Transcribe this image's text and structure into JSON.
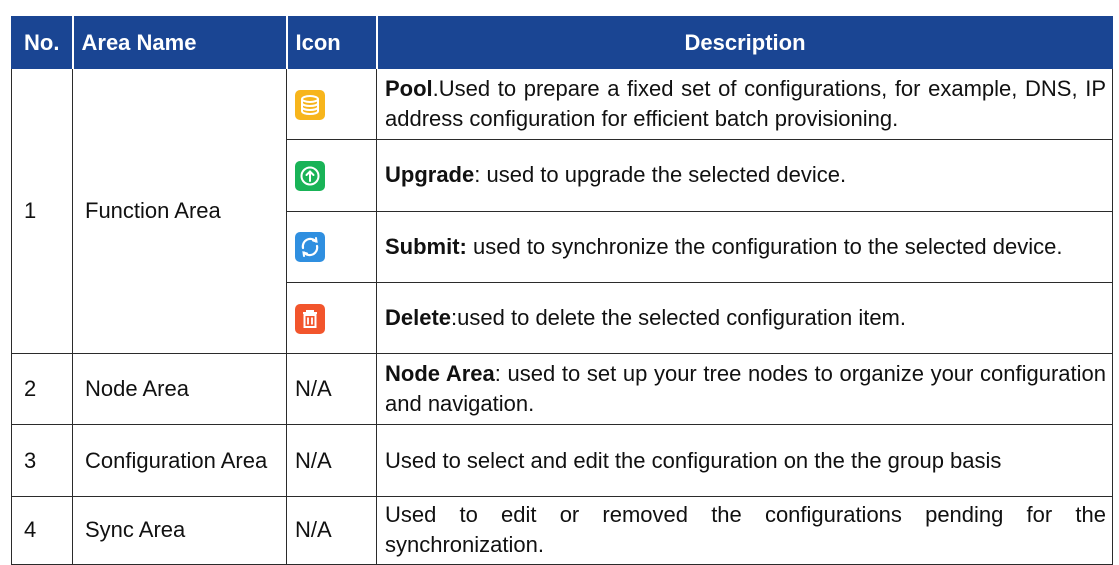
{
  "headers": {
    "no": "No.",
    "area": "Area Name",
    "icon": "Icon",
    "desc": "Description"
  },
  "row1": {
    "no": "1",
    "area": "Function Area",
    "items": [
      {
        "icon": "database-icon",
        "color": "#f7b51c",
        "bold": "Pool",
        "text": ".Used to prepare a fixed set of configurations, for example, DNS, IP address configuration for efficient batch provisioning."
      },
      {
        "icon": "upgrade-arrow-icon",
        "color": "#19b357",
        "bold": "Upgrade",
        "text": ": used to upgrade the selected device."
      },
      {
        "icon": "sync-icon",
        "color": "#2f8fe0",
        "bold": "Submit:",
        "text": " used to synchronize the configuration to the selected device."
      },
      {
        "icon": "trash-icon",
        "color": "#f2552c",
        "bold": "Delete",
        "text": ":used to delete the selected configuration item."
      }
    ]
  },
  "row2": {
    "no": "2",
    "area": "Node Area",
    "icon": "N/A",
    "bold": "Node Area",
    "text": ": used to set up your tree nodes to organize your configuration and navigation."
  },
  "row3": {
    "no": "3",
    "area": "Configuration Area",
    "icon": "N/A",
    "text": "Used to select and edit the configuration on the the group basis"
  },
  "row4": {
    "no": "4",
    "area": "Sync Area",
    "icon": "N/A",
    "text": "Used to edit or removed the configurations pending for the synchronization."
  }
}
